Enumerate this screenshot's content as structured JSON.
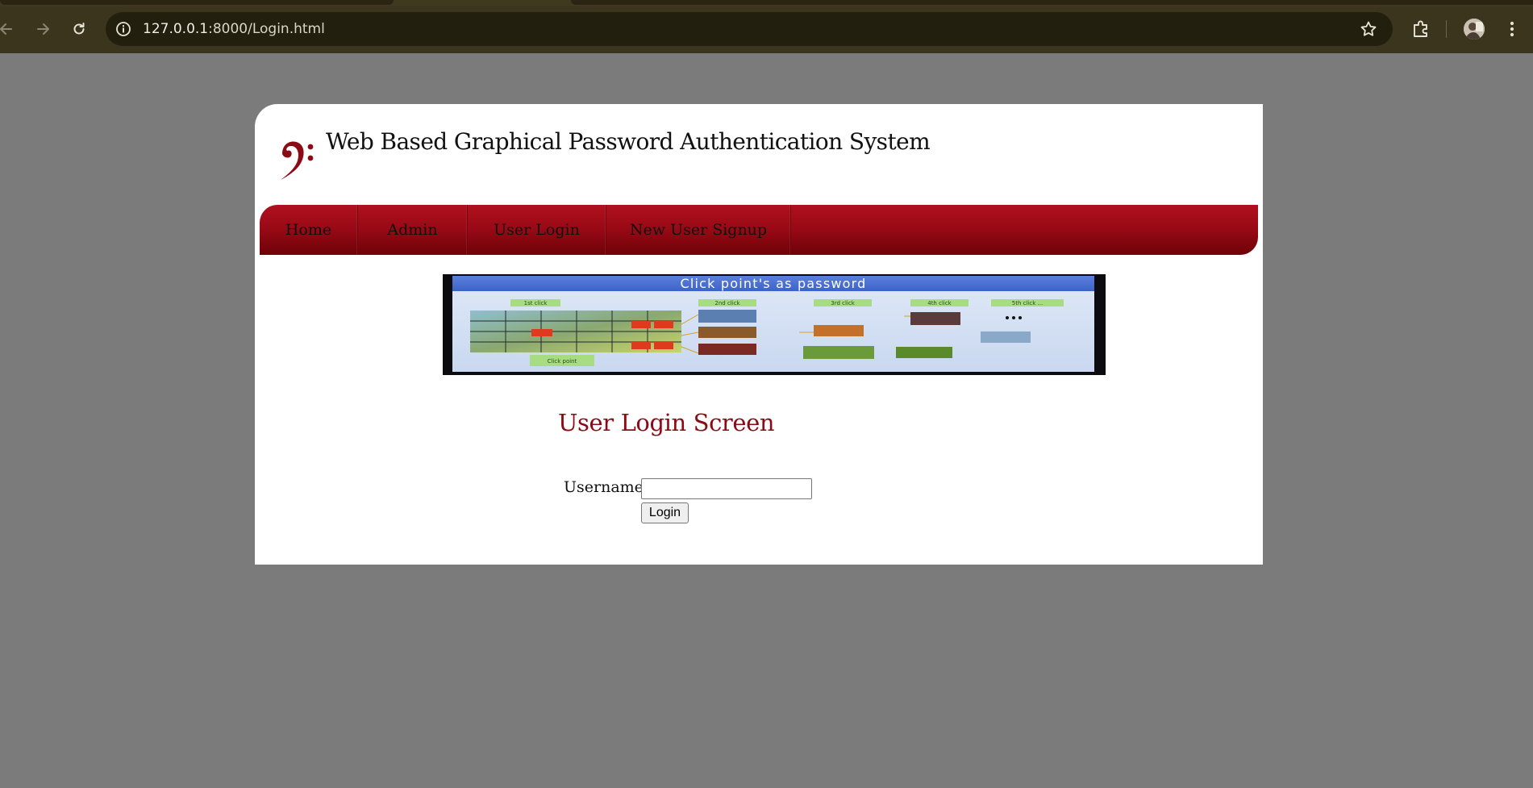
{
  "browser": {
    "url_host": "127.0.0.1",
    "url_rest": ":8000/Login.html",
    "icons": {
      "back": "arrow-left-icon",
      "forward": "arrow-right-icon",
      "reload": "reload-icon",
      "site_info": "info-icon",
      "bookmark": "star-icon",
      "extensions": "puzzle-icon",
      "profile": "avatar",
      "menu": "kebab-menu-icon"
    }
  },
  "site": {
    "title": "Web Based Graphical Password Authentication System",
    "logo": "bass-clef-icon",
    "accent_color": "#9a0a16"
  },
  "nav": {
    "items": [
      {
        "label": "Home"
      },
      {
        "label": "Admin"
      },
      {
        "label": "User Login"
      },
      {
        "label": "New User Signup"
      }
    ]
  },
  "banner": {
    "title": "Click point's as password",
    "steps": [
      "1st click",
      "2nd click",
      "3rd click",
      "4th click",
      "5th click ..."
    ],
    "note": "Click point"
  },
  "login": {
    "heading": "User Login Screen",
    "username_label": "Username",
    "username_value": "",
    "button_label": "Login"
  }
}
